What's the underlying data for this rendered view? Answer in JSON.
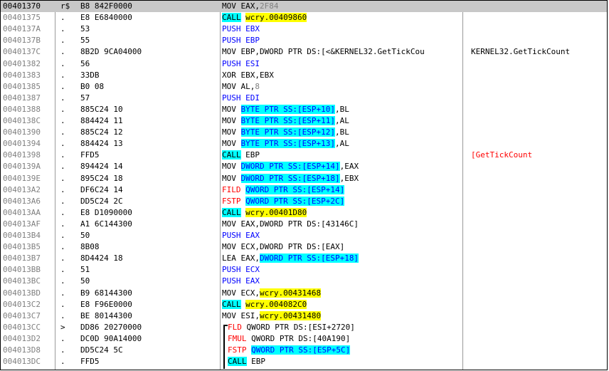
{
  "colors": {
    "selected_row": "#c8c8c8",
    "address_text": "#808080",
    "highlight_cyan": "#00ffff",
    "highlight_yellow": "#ffff00",
    "text_red": "#ff0000",
    "text_blue": "#0000ff"
  },
  "rows": [
    {
      "addr": "00401370",
      "mark": "r$",
      "hex": "B8 842F0000",
      "parts": [
        {
          "t": "MOV EAX,"
        },
        {
          "t": "2F84",
          "c": "t-gray"
        }
      ],
      "comment": "",
      "selected": true
    },
    {
      "addr": "00401375",
      "mark": ".",
      "hex": "E8 E6840000",
      "parts": [
        {
          "t": "CALL",
          "c": "t-cyan"
        },
        {
          "t": " "
        },
        {
          "t": "wcry.00409860",
          "c": "t-yellow"
        }
      ],
      "comment": ""
    },
    {
      "addr": "0040137A",
      "mark": ".",
      "hex": "53",
      "parts": [
        {
          "t": "PUSH EBX",
          "c": "t-blue"
        }
      ],
      "comment": ""
    },
    {
      "addr": "0040137B",
      "mark": ".",
      "hex": "55",
      "parts": [
        {
          "t": "PUSH EBP",
          "c": "t-blue"
        }
      ],
      "comment": ""
    },
    {
      "addr": "0040137C",
      "mark": ".",
      "hex": "8B2D 9CA04000",
      "parts": [
        {
          "t": "MOV EBP,DWORD PTR DS:[<&KERNEL32.GetTickCou"
        }
      ],
      "comment": "KERNEL32.GetTickCount"
    },
    {
      "addr": "00401382",
      "mark": ".",
      "hex": "56",
      "parts": [
        {
          "t": "PUSH ESI",
          "c": "t-blue"
        }
      ],
      "comment": ""
    },
    {
      "addr": "00401383",
      "mark": ".",
      "hex": "33DB",
      "parts": [
        {
          "t": "XOR EBX,EBX"
        }
      ],
      "comment": ""
    },
    {
      "addr": "00401385",
      "mark": ".",
      "hex": "B0 08",
      "parts": [
        {
          "t": "MOV AL,"
        },
        {
          "t": "8",
          "c": "t-gray"
        }
      ],
      "comment": ""
    },
    {
      "addr": "00401387",
      "mark": ".",
      "hex": "57",
      "parts": [
        {
          "t": "PUSH EDI",
          "c": "t-blue"
        }
      ],
      "comment": ""
    },
    {
      "addr": "00401388",
      "mark": ".",
      "hex": "885C24 10",
      "parts": [
        {
          "t": "MOV "
        },
        {
          "t": "BYTE PTR SS:[ESP+10]",
          "c": "t-cyanblue"
        },
        {
          "t": ",BL"
        }
      ],
      "comment": ""
    },
    {
      "addr": "0040138C",
      "mark": ".",
      "hex": "884424 11",
      "parts": [
        {
          "t": "MOV "
        },
        {
          "t": "BYTE PTR SS:[ESP+11]",
          "c": "t-cyanblue"
        },
        {
          "t": ",AL"
        }
      ],
      "comment": ""
    },
    {
      "addr": "00401390",
      "mark": ".",
      "hex": "885C24 12",
      "parts": [
        {
          "t": "MOV "
        },
        {
          "t": "BYTE PTR SS:[ESP+12]",
          "c": "t-cyanblue"
        },
        {
          "t": ",BL"
        }
      ],
      "comment": ""
    },
    {
      "addr": "00401394",
      "mark": ".",
      "hex": "884424 13",
      "parts": [
        {
          "t": "MOV "
        },
        {
          "t": "BYTE PTR SS:[ESP+13]",
          "c": "t-cyanblue"
        },
        {
          "t": ",AL"
        }
      ],
      "comment": ""
    },
    {
      "addr": "00401398",
      "mark": ".",
      "hex": "FFD5",
      "parts": [
        {
          "t": "CALL",
          "c": "t-cyan"
        },
        {
          "t": " EBP"
        }
      ],
      "comment": "[GetTickCount",
      "commentClass": "t-red"
    },
    {
      "addr": "0040139A",
      "mark": ".",
      "hex": "894424 14",
      "parts": [
        {
          "t": "MOV "
        },
        {
          "t": "DWORD PTR SS:[ESP+14]",
          "c": "t-cyanblue"
        },
        {
          "t": ",EAX"
        }
      ],
      "comment": ""
    },
    {
      "addr": "0040139E",
      "mark": ".",
      "hex": "895C24 18",
      "parts": [
        {
          "t": "MOV "
        },
        {
          "t": "DWORD PTR SS:[ESP+18]",
          "c": "t-cyanblue"
        },
        {
          "t": ",EBX"
        }
      ],
      "comment": ""
    },
    {
      "addr": "004013A2",
      "mark": ".",
      "hex": "DF6C24 14",
      "parts": [
        {
          "t": "FILD",
          "c": "t-red"
        },
        {
          "t": " "
        },
        {
          "t": "QWORD PTR SS:[ESP+14]",
          "c": "t-cyanblue"
        }
      ],
      "comment": ""
    },
    {
      "addr": "004013A6",
      "mark": ".",
      "hex": "DD5C24 2C",
      "parts": [
        {
          "t": "FSTP",
          "c": "t-red"
        },
        {
          "t": " "
        },
        {
          "t": "QWORD PTR SS:[ESP+2C]",
          "c": "t-cyanblue"
        }
      ],
      "comment": ""
    },
    {
      "addr": "004013AA",
      "mark": ".",
      "hex": "E8 D1090000",
      "parts": [
        {
          "t": "CALL",
          "c": "t-cyan"
        },
        {
          "t": " "
        },
        {
          "t": "wcry.00401D80",
          "c": "t-yellow"
        }
      ],
      "comment": ""
    },
    {
      "addr": "004013AF",
      "mark": ".",
      "hex": "A1 6C144300",
      "parts": [
        {
          "t": "MOV EAX,DWORD PTR DS:[43146C]"
        }
      ],
      "comment": ""
    },
    {
      "addr": "004013B4",
      "mark": ".",
      "hex": "50",
      "parts": [
        {
          "t": "PUSH EAX",
          "c": "t-blue"
        }
      ],
      "comment": ""
    },
    {
      "addr": "004013B5",
      "mark": ".",
      "hex": "8B08",
      "parts": [
        {
          "t": "MOV ECX,DWORD PTR DS:[EAX]"
        }
      ],
      "comment": ""
    },
    {
      "addr": "004013B7",
      "mark": ".",
      "hex": "8D4424 18",
      "parts": [
        {
          "t": "LEA EAX,"
        },
        {
          "t": "DWORD PTR SS:[ESP+18]",
          "c": "t-cyanblue"
        }
      ],
      "comment": ""
    },
    {
      "addr": "004013BB",
      "mark": ".",
      "hex": "51",
      "parts": [
        {
          "t": "PUSH ECX",
          "c": "t-blue"
        }
      ],
      "comment": ""
    },
    {
      "addr": "004013BC",
      "mark": ".",
      "hex": "50",
      "parts": [
        {
          "t": "PUSH EAX",
          "c": "t-blue"
        }
      ],
      "comment": ""
    },
    {
      "addr": "004013BD",
      "mark": ".",
      "hex": "B9 68144300",
      "parts": [
        {
          "t": "MOV ECX,"
        },
        {
          "t": "wcry.00431468",
          "c": "t-yellow"
        }
      ],
      "comment": ""
    },
    {
      "addr": "004013C2",
      "mark": ".",
      "hex": "E8 F96E0000",
      "parts": [
        {
          "t": "CALL",
          "c": "t-cyan"
        },
        {
          "t": " "
        },
        {
          "t": "wcry.004082C0",
          "c": "t-yellow"
        }
      ],
      "comment": ""
    },
    {
      "addr": "004013C7",
      "mark": ".",
      "hex": "BE 80144300",
      "parts": [
        {
          "t": "MOV ESI,"
        },
        {
          "t": "wcry.00431480",
          "c": "t-yellow"
        }
      ],
      "comment": ""
    },
    {
      "addr": "004013CC",
      "mark": ">",
      "hex": "DD86 20270000",
      "parts": [
        {
          "t": "FLD",
          "c": "t-red"
        },
        {
          "t": " QWORD PTR DS:[ESI+2720]"
        }
      ],
      "comment": "",
      "indent": 1
    },
    {
      "addr": "004013D2",
      "mark": ".",
      "hex": "DC0D 90A14000",
      "parts": [
        {
          "t": "FMUL",
          "c": "t-red"
        },
        {
          "t": " QWORD PTR DS:[40A190]"
        }
      ],
      "comment": "",
      "indent": 1
    },
    {
      "addr": "004013D8",
      "mark": ".",
      "hex": "DD5C24 5C",
      "parts": [
        {
          "t": "FSTP",
          "c": "t-red"
        },
        {
          "t": " "
        },
        {
          "t": "QWORD PTR SS:[ESP+5C]",
          "c": "t-cyanblue"
        }
      ],
      "comment": "",
      "indent": 1
    },
    {
      "addr": "004013DC",
      "mark": ".",
      "hex": "FFD5",
      "parts": [
        {
          "t": "CALL",
          "c": "t-cyan"
        },
        {
          "t": " EBP"
        }
      ],
      "comment": "",
      "indent": 1
    }
  ]
}
